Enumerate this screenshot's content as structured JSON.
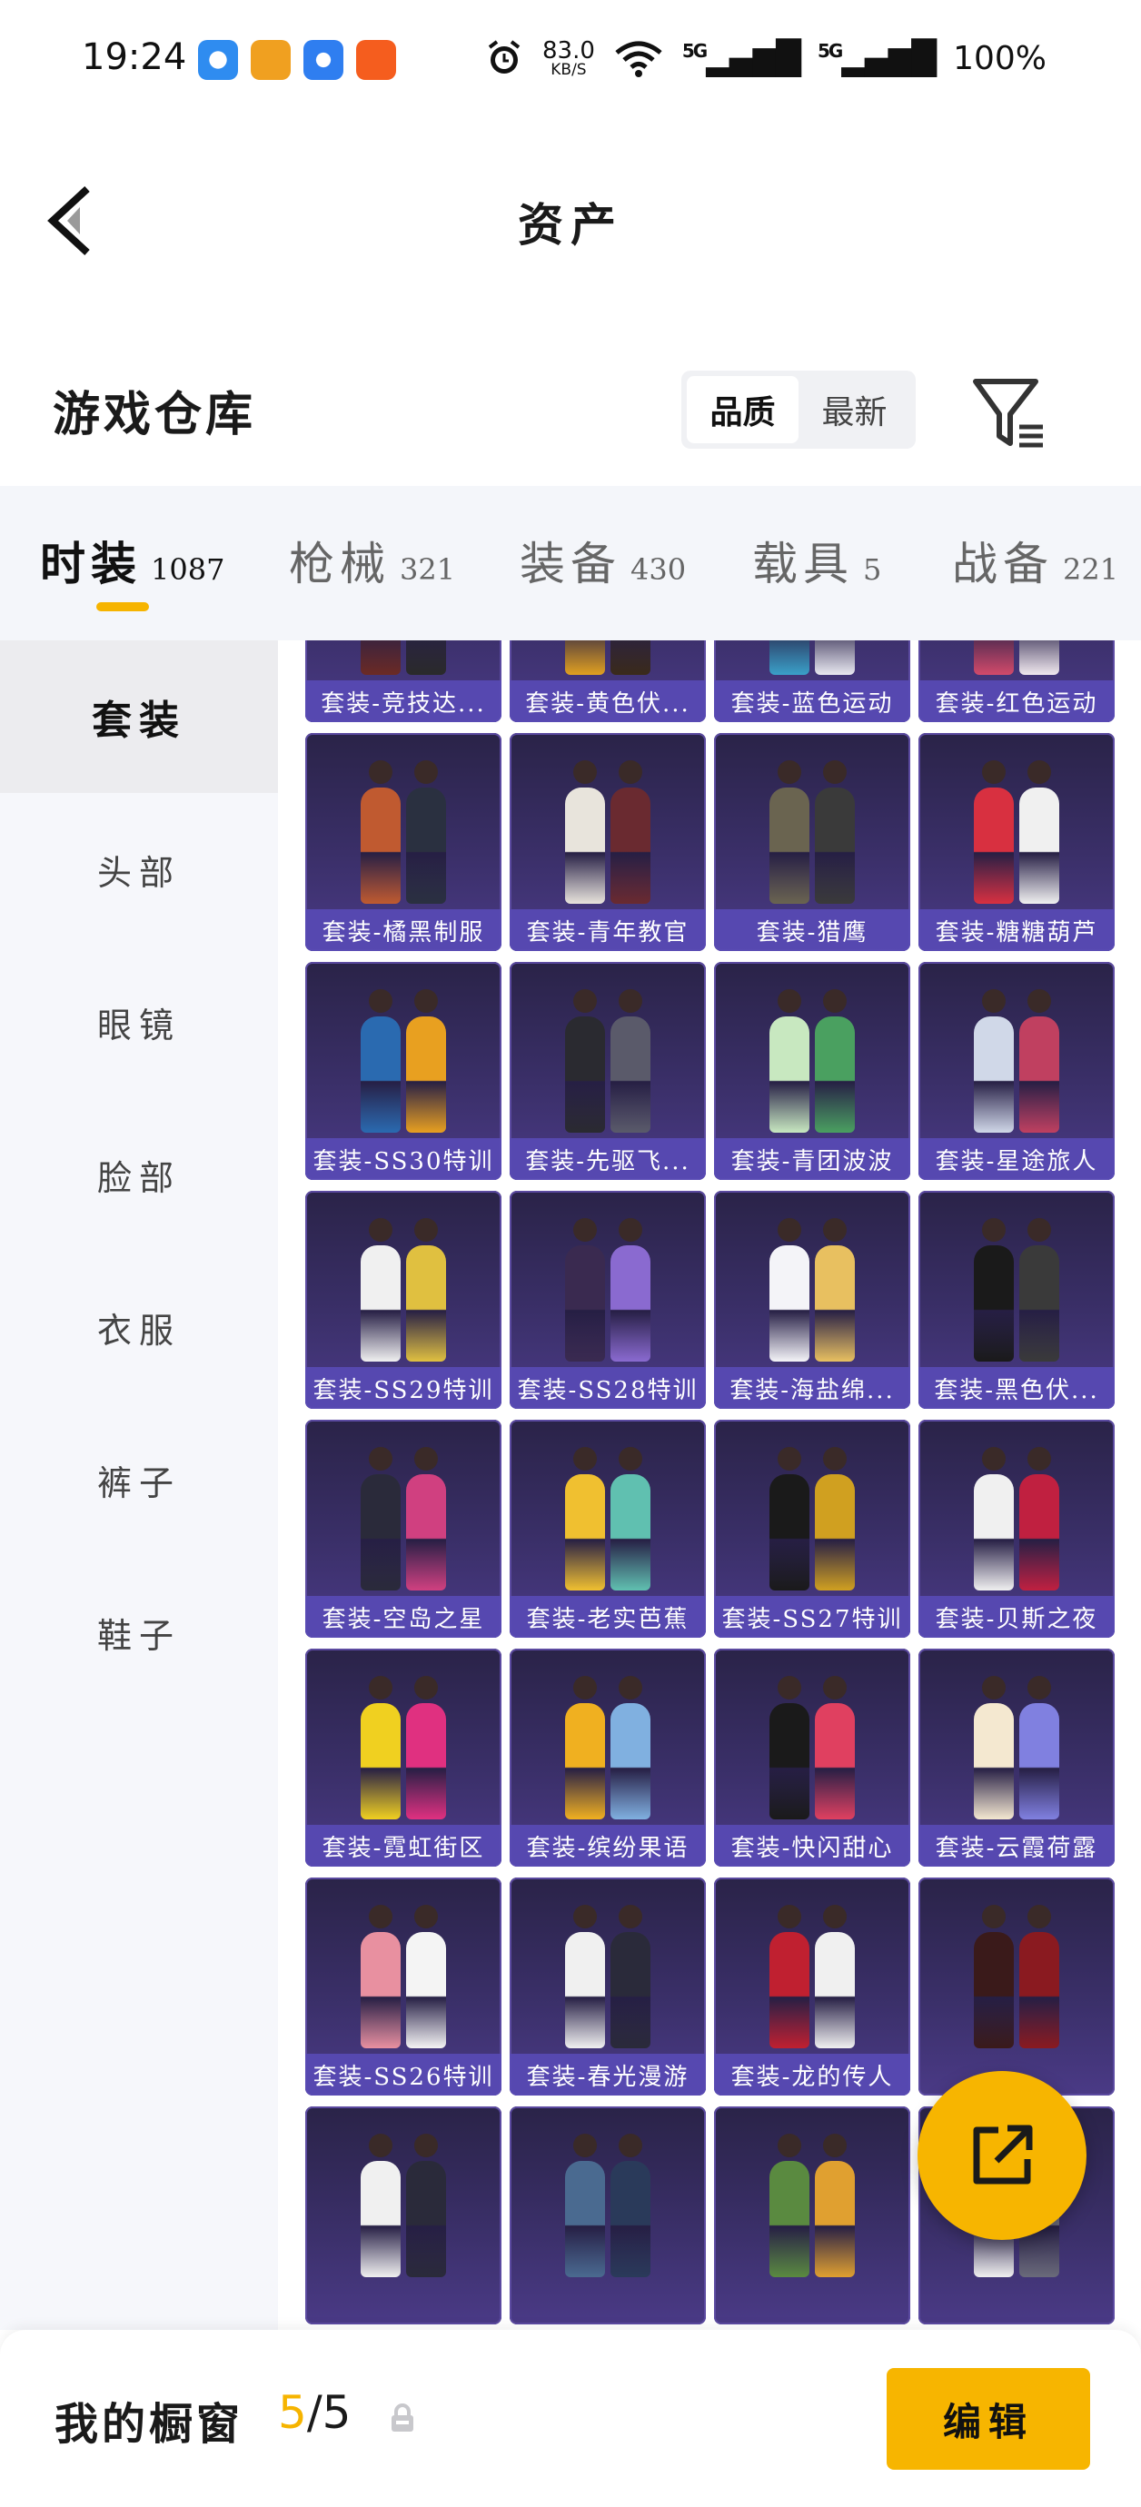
{
  "status_bar": {
    "time": "19:24",
    "net_speed_value": "83.0",
    "net_speed_unit": "KB/S",
    "signal1": "5G",
    "signal2": "5G",
    "battery": "100%"
  },
  "header": {
    "title": "资产",
    "back_icon": "chevron-left-icon"
  },
  "warehouse": {
    "title": "游戏仓库",
    "sort_options": [
      "品质",
      "最新"
    ],
    "sort_selected": "品质",
    "filter_icon": "filter-icon"
  },
  "tabs": [
    {
      "label": "时装",
      "count": "1087",
      "active": true
    },
    {
      "label": "枪械",
      "count": "321",
      "active": false
    },
    {
      "label": "装备",
      "count": "430",
      "active": false
    },
    {
      "label": "载具",
      "count": "5",
      "active": false
    },
    {
      "label": "战备",
      "count": "221",
      "active": false
    }
  ],
  "sidebar": {
    "items": [
      "套装",
      "头部",
      "眼镜",
      "脸部",
      "衣服",
      "裤子",
      "鞋子"
    ],
    "active": "套装"
  },
  "grid": {
    "items": [
      "套装-竞技达...",
      "套装-黄色伏...",
      "套装-蓝色运动",
      "套装-红色运动",
      "套装-橘黑制服",
      "套装-青年教官",
      "套装-猎鹰",
      "套装-糖糖葫芦",
      "套装-SS30特训",
      "套装-先驱飞...",
      "套装-青团波波",
      "套装-星途旅人",
      "套装-SS29特训",
      "套装-SS28特训",
      "套装-海盐绵...",
      "套装-黑色伏...",
      "套装-空岛之星",
      "套装-老实芭蕉",
      "套装-SS27特训",
      "套装-贝斯之夜",
      "套装-霓虹街区",
      "套装-缤纷果语",
      "套装-快闪甜心",
      "套装-云霞荷露",
      "套装-SS26特训",
      "套装-春光漫游",
      "套装-龙的传人",
      "",
      "",
      "",
      "",
      ""
    ]
  },
  "fab": {
    "icon": "share-external-icon"
  },
  "bottom_bar": {
    "label": "我的橱窗",
    "count_current": "5",
    "count_total": "/5",
    "lock_icon": "lock-icon",
    "edit_label": "编辑"
  },
  "colors": {
    "accent": "#f7b500",
    "card_bg": "#3a2f68",
    "card_label_bg": "#584ab4"
  }
}
